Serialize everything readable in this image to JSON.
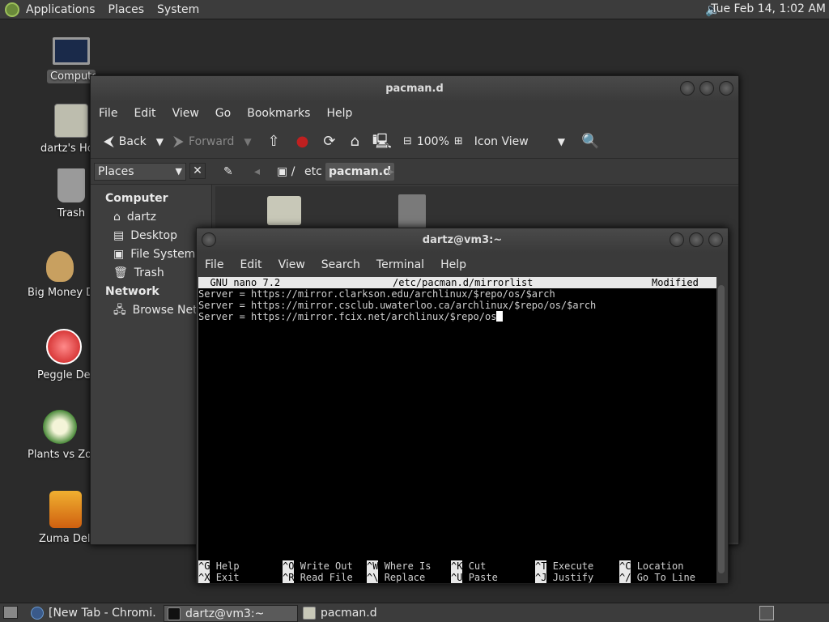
{
  "top_panel": {
    "menus": [
      "Applications",
      "Places",
      "System"
    ],
    "clock": "Tue Feb 14,  1:02 AM",
    "volume_icon": "speaker-icon"
  },
  "desktop_icons": [
    {
      "label": "Computer",
      "icon": "computer-icon"
    },
    {
      "label": "dartz's Home",
      "icon": "home-folder-icon"
    },
    {
      "label": "Trash",
      "icon": "trash-icon"
    },
    {
      "label": "Big Money Deluxe",
      "icon": "money-bag-icon"
    },
    {
      "label": "Peggle Deluxe",
      "icon": "peggle-icon"
    },
    {
      "label": "Plants vs Zombies",
      "icon": "plants-icon"
    },
    {
      "label": "Zuma Deluxe",
      "icon": "zuma-icon"
    }
  ],
  "file_manager": {
    "title": "pacman.d",
    "menus": [
      "File",
      "Edit",
      "View",
      "Go",
      "Bookmarks",
      "Help"
    ],
    "toolbar": {
      "back": "Back",
      "forward": "Forward",
      "zoom": "100%",
      "view_mode": "Icon View"
    },
    "places_dropdown": "Places",
    "breadcrumbs": [
      "/",
      "etc",
      "pacman.d"
    ],
    "sidebar": {
      "computer_header": "Computer",
      "computer_items": [
        "dartz",
        "Desktop",
        "File System",
        "Trash"
      ],
      "network_header": "Network",
      "network_items": [
        "Browse Net..."
      ]
    }
  },
  "terminal": {
    "title": "dartz@vm3:~",
    "menus": [
      "File",
      "Edit",
      "View",
      "Search",
      "Terminal",
      "Help"
    ],
    "nano": {
      "version": "  GNU nano 7.2",
      "file": "/etc/pacman.d/mirrorlist",
      "status": "Modified",
      "lines": [
        "Server = https://mirror.clarkson.edu/archlinux/$repo/os/$arch",
        "Server = https://mirror.csclub.uwaterloo.ca/archlinux/$repo/os/$arch",
        "Server = https://mirror.fcix.net/archlinux/$repo/os"
      ],
      "shortcuts": [
        {
          "key": "^G",
          "label": "Help"
        },
        {
          "key": "^O",
          "label": "Write Out"
        },
        {
          "key": "^W",
          "label": "Where Is"
        },
        {
          "key": "^K",
          "label": "Cut"
        },
        {
          "key": "^T",
          "label": "Execute"
        },
        {
          "key": "^C",
          "label": "Location"
        },
        {
          "key": "^X",
          "label": "Exit"
        },
        {
          "key": "^R",
          "label": "Read File"
        },
        {
          "key": "^\\",
          "label": "Replace"
        },
        {
          "key": "^U",
          "label": "Paste"
        },
        {
          "key": "^J",
          "label": "Justify"
        },
        {
          "key": "^/",
          "label": "Go To Line"
        }
      ]
    }
  },
  "taskbar": {
    "items": [
      "[New Tab - Chromi...",
      "dartz@vm3:~",
      "pacman.d"
    ]
  }
}
